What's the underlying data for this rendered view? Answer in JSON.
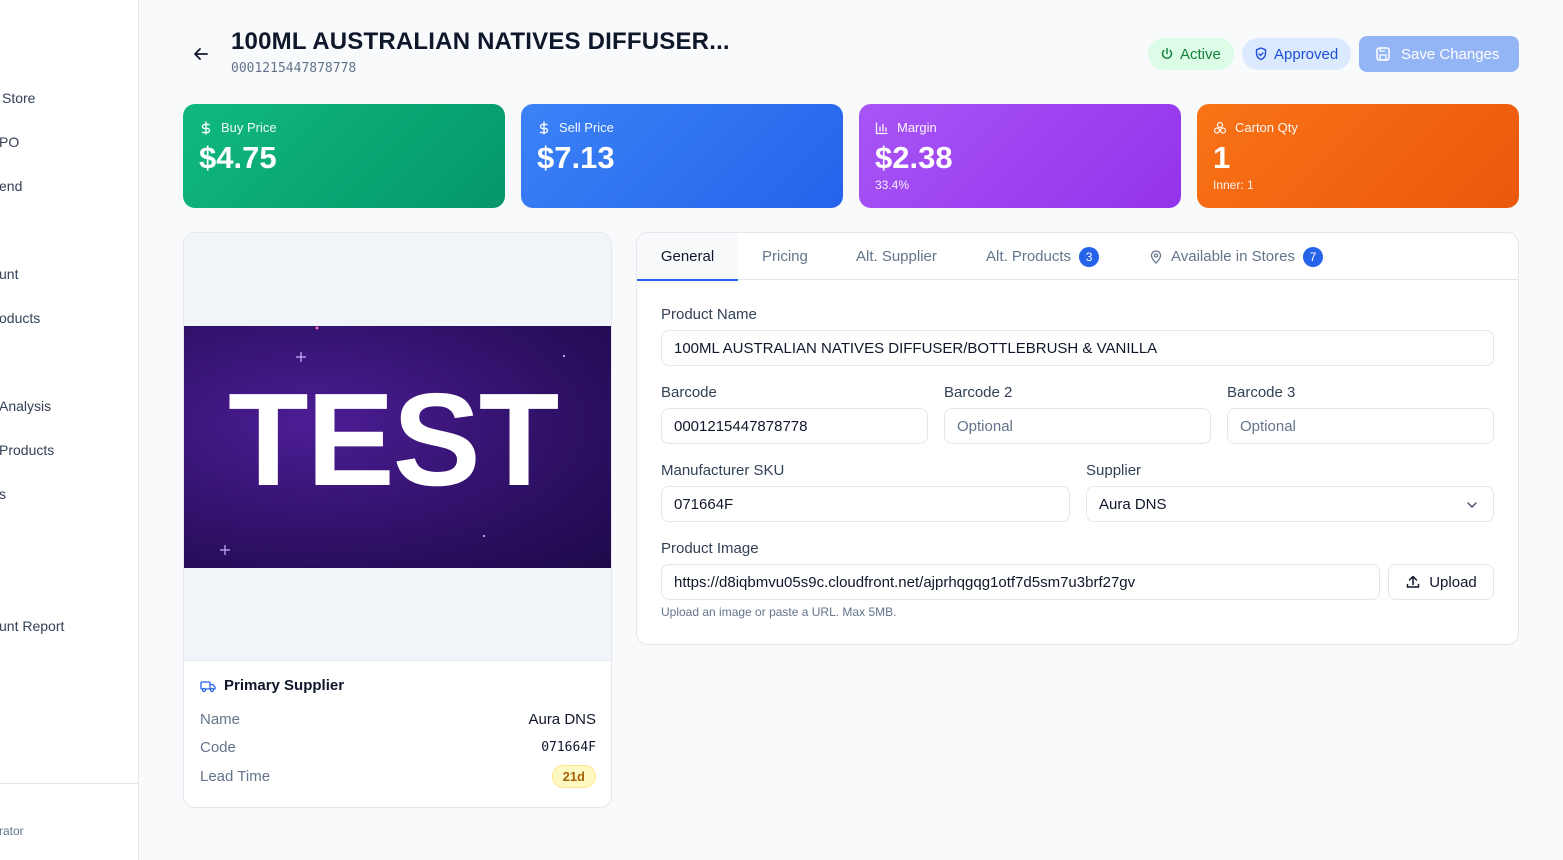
{
  "sidebar": {
    "items": [
      {
        "label": "Store"
      },
      {
        "label": "PO"
      },
      {
        "label": "end"
      },
      {
        "label": "unt"
      },
      {
        "label": "oducts"
      },
      {
        "label": "Analysis"
      },
      {
        "label": "Products"
      },
      {
        "label": "s"
      },
      {
        "label": "unt Report"
      }
    ],
    "role": "rator"
  },
  "header": {
    "title": "100ML AUSTRALIAN NATIVES DIFFUSER...",
    "barcode": "0001215447878778",
    "status_active": "Active",
    "status_approved": "Approved",
    "save_label": "Save Changes"
  },
  "stats": {
    "buy": {
      "label": "Buy Price",
      "value": "$4.75"
    },
    "sell": {
      "label": "Sell Price",
      "value": "$7.13"
    },
    "margin": {
      "label": "Margin",
      "value": "$2.38",
      "sub": "33.4%"
    },
    "carton": {
      "label": "Carton Qty",
      "value": "1",
      "sub": "Inner: 1"
    }
  },
  "image_card": {
    "image_text": "TEST",
    "supplier_title": "Primary Supplier",
    "name_label": "Name",
    "name_value": "Aura DNS",
    "code_label": "Code",
    "code_value": "071664F",
    "lead_label": "Lead Time",
    "lead_value": "21d"
  },
  "tabs": [
    {
      "label": "General"
    },
    {
      "label": "Pricing"
    },
    {
      "label": "Alt. Supplier"
    },
    {
      "label": "Alt. Products",
      "count": "3"
    },
    {
      "label": "Available in Stores",
      "count": "7"
    }
  ],
  "form": {
    "product_name_label": "Product Name",
    "product_name_value": "100ML AUSTRALIAN NATIVES DIFFUSER/BOTTLEBRUSH & VANILLA",
    "barcode_label": "Barcode",
    "barcode_value": "0001215447878778",
    "barcode2_label": "Barcode 2",
    "barcode2_placeholder": "Optional",
    "barcode3_label": "Barcode 3",
    "barcode3_placeholder": "Optional",
    "sku_label": "Manufacturer SKU",
    "sku_value": "071664F",
    "supplier_label": "Supplier",
    "supplier_value": "Aura DNS",
    "image_label": "Product Image",
    "image_value": "https://d8iqbmvu05s9c.cloudfront.net/ajprhqgqg1otf7d5sm7u3brf27gv",
    "upload_label": "Upload",
    "help_text": "Upload an image or paste a URL. Max 5MB."
  },
  "colors": {
    "buy": "#10b981",
    "sell": "#3b82f6",
    "margin": "#a855f7",
    "carton": "#f97316",
    "accent": "#2563eb"
  }
}
